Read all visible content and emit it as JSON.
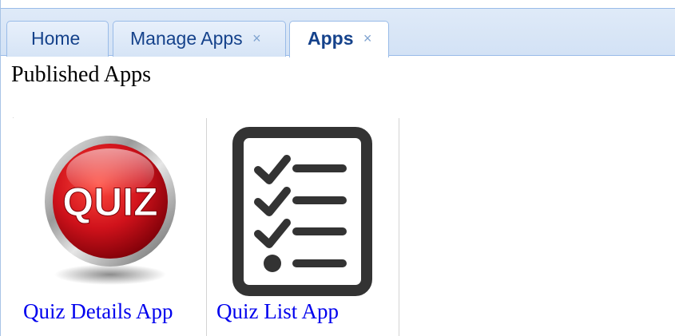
{
  "tabs": [
    {
      "label": "Home",
      "closable": false,
      "active": false
    },
    {
      "label": "Manage Apps",
      "closable": true,
      "active": false
    },
    {
      "label": "Apps",
      "closable": true,
      "active": true
    }
  ],
  "close_glyph": "×",
  "page": {
    "heading": "Published Apps"
  },
  "apps": [
    {
      "name": "Quiz Details App",
      "icon": "quiz-badge-icon",
      "icon_text": "QUIZ"
    },
    {
      "name": "Quiz List App",
      "icon": "checklist-icon"
    }
  ],
  "colors": {
    "tab_text": "#15428b",
    "link": "#0000ee",
    "quiz_red": "#d0121b"
  }
}
